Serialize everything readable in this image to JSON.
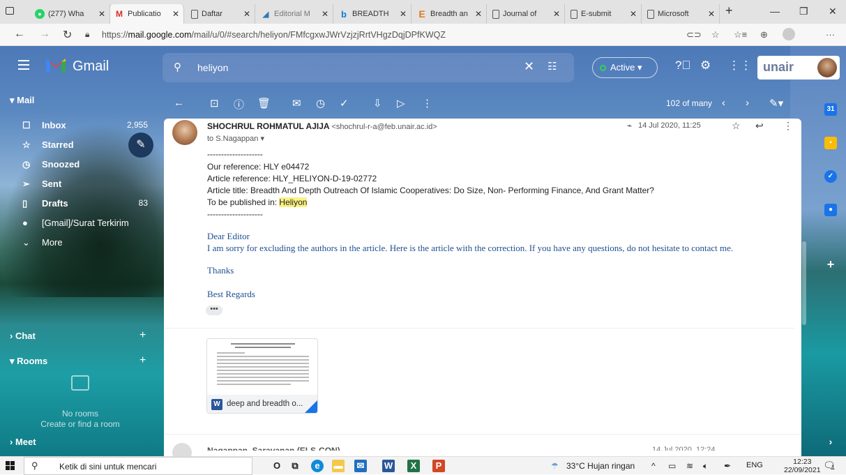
{
  "browser": {
    "tabs": [
      {
        "label": "(277) Wha",
        "favicon": "whatsapp-icon",
        "active": false
      },
      {
        "label": "Publicatio",
        "favicon": "gmail-icon",
        "active": true
      },
      {
        "label": "Daftar",
        "favicon": "page-icon",
        "active": false
      },
      {
        "label": "Editorial M",
        "favicon": "editorial-icon",
        "active": false
      },
      {
        "label": "BREADTH",
        "favicon": "bing-icon",
        "active": false
      },
      {
        "label": "Breadth an",
        "favicon": "e-icon",
        "active": false
      },
      {
        "label": "Journal of",
        "favicon": "page-icon",
        "active": false
      },
      {
        "label": "E-submit",
        "favicon": "page-icon",
        "active": false
      },
      {
        "label": "Microsoft",
        "favicon": "page-icon",
        "active": false
      }
    ],
    "new_tab": "+",
    "url_prefix": "https://",
    "url_host": "mail.google.com",
    "url_path": "/mail/u/0/#search/heliyon/FMfcgxwJWrVzjzjRrtVHgzDqjDPfKWQZ"
  },
  "gmail": {
    "app_name": "Gmail",
    "search_value": "heliyon",
    "status_label": "Active",
    "brand_text": "unair",
    "nav": {
      "mail_section": "Mail",
      "items": [
        {
          "label": "Inbox",
          "icon": "inbox-icon",
          "count": "2,955"
        },
        {
          "label": "Starred",
          "icon": "star-icon",
          "count": ""
        },
        {
          "label": "Snoozed",
          "icon": "clock-icon",
          "count": ""
        },
        {
          "label": "Sent",
          "icon": "send-icon",
          "count": ""
        },
        {
          "label": "Drafts",
          "icon": "draft-icon",
          "count": "83"
        },
        {
          "label": "[Gmail]/Surat Terkirim",
          "icon": "label-icon",
          "count": ""
        },
        {
          "label": "More",
          "icon": "chevron-down-icon",
          "count": ""
        }
      ],
      "chat_section": "Chat",
      "rooms_section": "Rooms",
      "no_rooms": "No rooms",
      "create_room": "Create or find a room",
      "meet_section": "Meet"
    },
    "toolbar": {
      "pager": "102 of many"
    },
    "message": {
      "sender_name": "SHOCHRUL ROHMATUL AJIJA",
      "sender_email": "<shochrul-r-a@feb.unair.ac.id>",
      "to": "to S.Nagappan",
      "date": "14 Jul 2020, 11:25",
      "separator": "--------------------",
      "our_reference": "Our reference: HLY e04472",
      "article_reference": "Article reference: HLY_HELIYON-D-19-02772",
      "article_title": "Article title:  Breadth And Depth Outreach Of Islamic Cooperatives: Do Size, Non- Performing Finance, And Grant Matter?",
      "published_prefix": "To be published in: ",
      "published_journal": "Heliyon",
      "greeting": "Dear Editor",
      "body": "I am sorry for excluding the authors in the article. Here is the article with the correction. If you have any questions, do not hesitate to contact me.",
      "thanks": "Thanks",
      "regards": "Best Regards",
      "ellipsis": "•••",
      "attachment_name": "deep and breadth o..."
    },
    "next_message": {
      "sender": "Nagappan, Saravanan (ELS-CON)",
      "date": "14 Jul 2020, 12:24"
    }
  },
  "taskbar": {
    "search_placeholder": "Ketik di sini untuk mencari",
    "weather": "33°C  Hujan ringan",
    "language": "ENG",
    "time": "12:23",
    "date": "22/09/2021",
    "notif_count": "1"
  }
}
